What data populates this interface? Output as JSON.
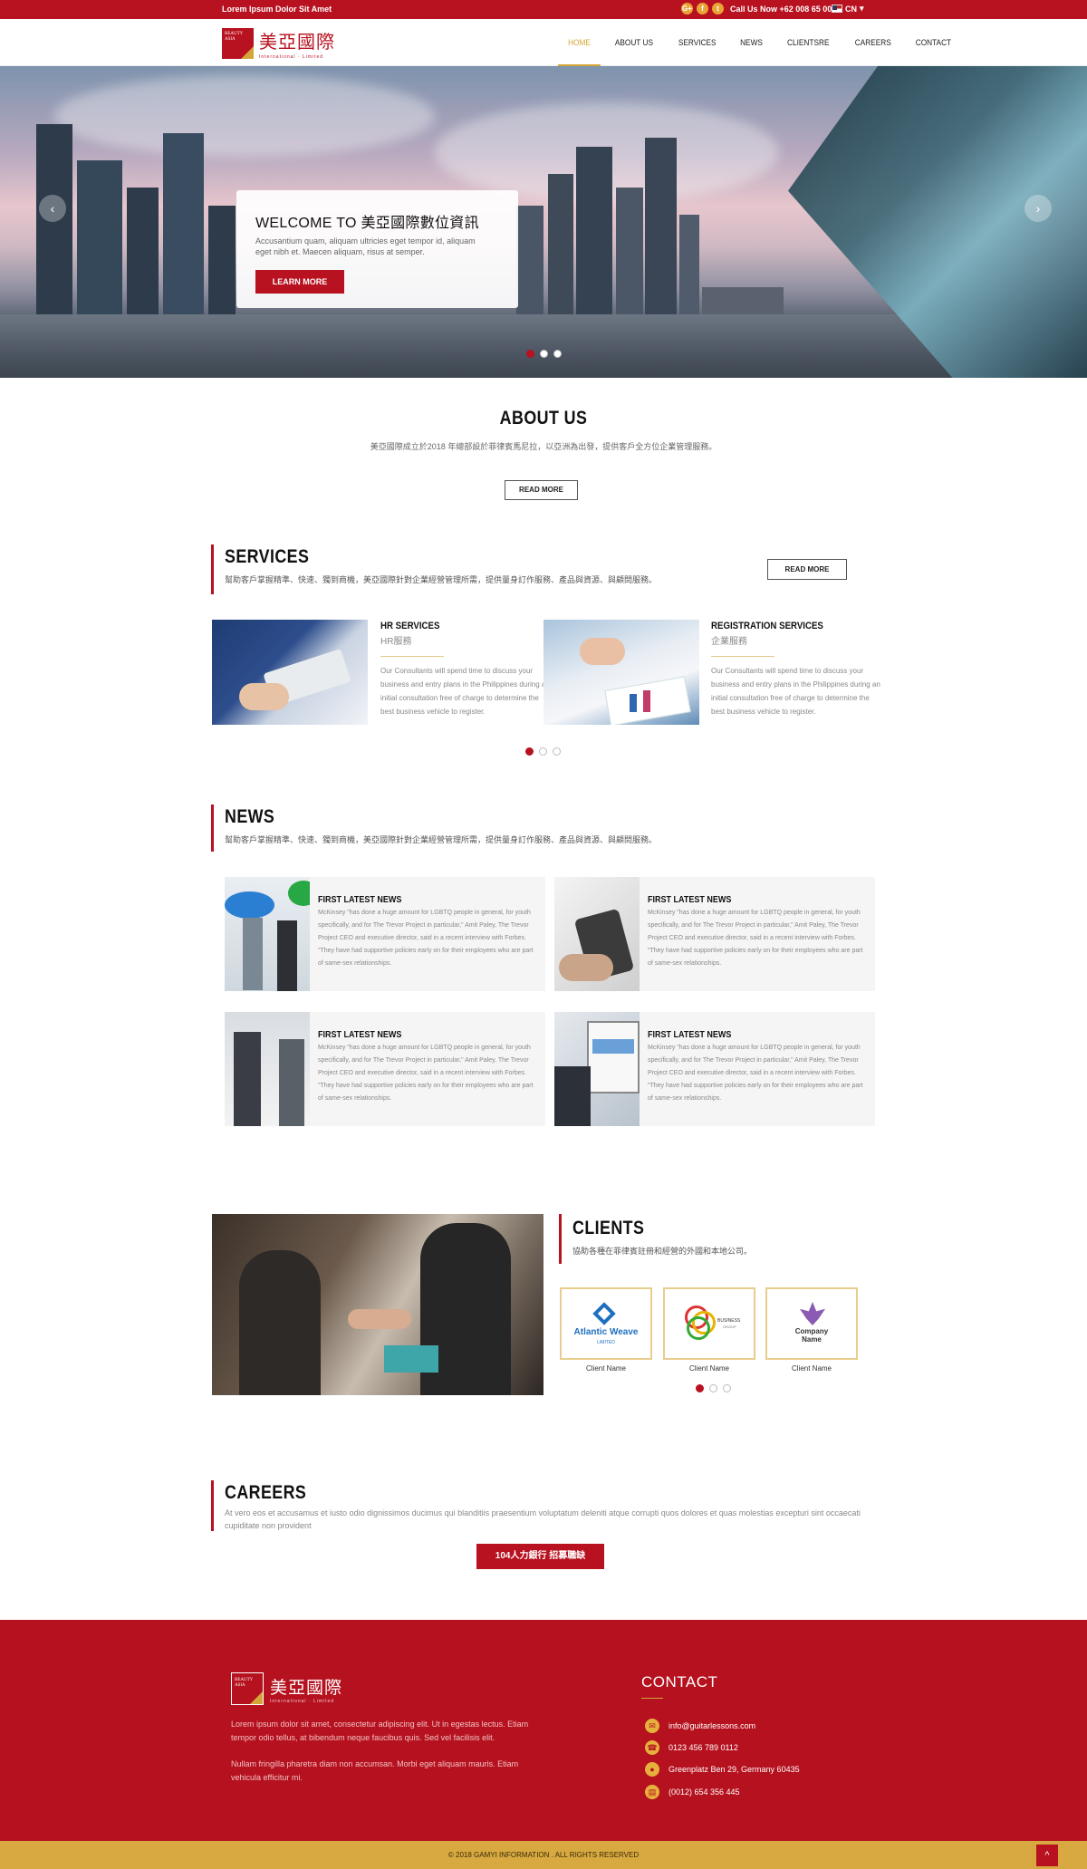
{
  "topbar": {
    "tagline": "Lorem Ipsum Dolor Sit Amet",
    "social": [
      "G+",
      "f",
      "t"
    ],
    "phone": "Call Us Now +62 008 65 001",
    "lang": "CN"
  },
  "header": {
    "logo_box": "BEAUTY ASIA",
    "logo_text": "美亞國際",
    "logo_sub": "International · Limited",
    "nav": [
      "HOME",
      "ABOUT US",
      "SERVICES",
      "NEWS",
      "CLIENTSRE",
      "CAREERS",
      "CONTACT"
    ]
  },
  "hero": {
    "title": "WELCOME TO  美亞國際數位資訊",
    "text": "Accusantium quam, aliquam ultricies eget tempor id, aliquam eget nibh et. Maecen aliquam, risus at semper.",
    "button": "LEARN MORE",
    "prev": "‹",
    "next": "›"
  },
  "about": {
    "title": "ABOUT US",
    "text": "美亞國際成立於2018 年總部設於菲律賓馬尼拉，以亞洲為出發，提供客戶全方位企業管理服務。",
    "button": "READ MORE"
  },
  "services": {
    "title": "SERVICES",
    "subtitle": "幫助客戶掌握精準、快速、獨到商機，美亞國際針對企業經營管理所需，提供量身訂作服務、產品與資源、與顧問服務。",
    "button": "READ MORE",
    "items": [
      {
        "title": "HR SERVICES",
        "sub": "HR服務",
        "text": "Our Consultants will spend time to discuss your business and entry plans in the Philippines during an initial consultation free of charge to determine the best business vehicle to register."
      },
      {
        "title": "REGISTRATION SERVICES",
        "sub": "企業服務",
        "text": "Our Consultants will spend time to discuss your business and entry plans in the Philippines during an initial consultation free of charge to determine the best business vehicle to register."
      }
    ]
  },
  "news": {
    "title": "NEWS",
    "subtitle": "幫助客戶掌握精準、快速、獨到商機，美亞國際針對企業經營管理所需，提供量身訂作服務、產品與資源、與顧問服務。",
    "items": [
      {
        "title": "FIRST LATEST NEWS",
        "text": "McKinsey \"has done a huge amount for LGBTQ people in general, for youth specifically, and for The Trevor Project in particular,\" Amit Paley, The Trevor Project CEO and executive director, said in a recent interview with Forbes. \"They have had supportive policies early on for their employees who are part of same-sex relationships."
      },
      {
        "title": "FIRST LATEST NEWS",
        "text": "McKinsey \"has done a huge amount for LGBTQ people in general, for youth specifically, and for The Trevor Project in particular,\" Amit Paley, The Trevor Project CEO and executive director, said in a recent interview with Forbes. \"They have had supportive policies early on for their employees who are part of same-sex relationships."
      },
      {
        "title": "FIRST LATEST NEWS",
        "text": "McKinsey \"has done a huge amount for LGBTQ people in general, for youth specifically, and for The Trevor Project in particular,\" Amit Paley, The Trevor Project CEO and executive director, said in a recent interview with Forbes. \"They have had supportive policies early on for their employees who are part of same-sex relationships."
      },
      {
        "title": "FIRST LATEST NEWS",
        "text": "McKinsey \"has done a huge amount for LGBTQ people in general, for youth specifically, and for The Trevor Project in particular,\" Amit Paley, The Trevor Project CEO and executive director, said in a recent interview with Forbes. \"They have had supportive policies early on for their employees who are part of same-sex relationships."
      }
    ]
  },
  "clients": {
    "title": "CLIENTS",
    "subtitle": "協助各種在菲律賓註冊和經營的外國和本地公司。",
    "items": [
      {
        "logo": "Atlantic Weave",
        "logo_sub": "LIMITED",
        "name": "Client Name"
      },
      {
        "logo": "BUSINESS",
        "logo_sub": "GROUP",
        "name": "Client Name"
      },
      {
        "logo": "Company Name",
        "logo_sub": "",
        "name": "Client Name"
      }
    ]
  },
  "careers": {
    "title": "CAREERS",
    "text": "At vero eos et accusamus et iusto odio dignissimos ducimus qui blanditiis praesentium voluptatum deleniti atque corrupti quos dolores et quas molestias excepturi sint occaecati cupiditate non provident",
    "button": "104人力銀行 招募職缺"
  },
  "footer": {
    "logo_box": "BEAUTY ASIA",
    "logo_text": "美亞國際",
    "logo_sub": "International · Limited",
    "p1": "Lorem ipsum dolor sit amet, consectetur adipiscing elit. Ut in egestas lectus. Etiam tempor odio tellus, at bibendum neque faucibus quis. Sed vel facilisis elit.",
    "p2": "Nullam fringilla pharetra diam non accumsan. Morbi eget aliquam mauris. Etiam vehicula efficitur mi.",
    "contact_title": "CONTACT",
    "email": "info@guitarlessons.com",
    "phone": "0123 456 789 0112",
    "address": "Greenplatz Ben 29, Germany 60435",
    "fax": "(0012) 654 356 445",
    "copyright": "© 2018 GAMYI INFORMATION . ALL RIGHTS RESERVED",
    "to_top": "^"
  },
  "colors": {
    "brand_red": "#b8111f",
    "gold": "#d4a63a"
  }
}
